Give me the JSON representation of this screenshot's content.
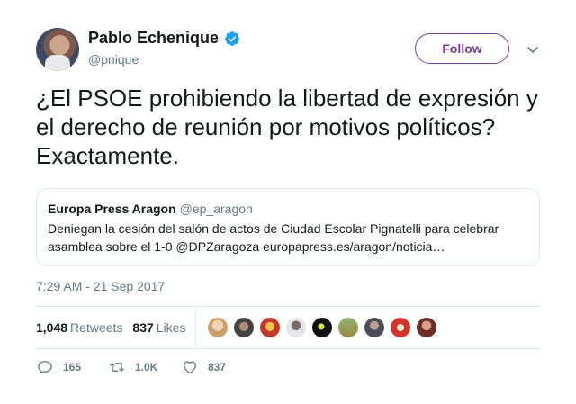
{
  "author": {
    "name": "Pablo Echenique",
    "handle": "@pnique",
    "verified": true
  },
  "follow_label": "Follow",
  "tweet_text": "¿El PSOE prohibiendo la libertad de expresión y el derecho de reunión por motivos políticos? Exactamente.",
  "quoted": {
    "name": "Europa Press Aragon",
    "handle": "@ep_aragon",
    "text": "Deniegan la cesión del salón de actos de Ciudad Escolar Pignatelli para celebrar asamblea sobre el 1-0 @DPZaragoza europapress.es/aragon/noticia…"
  },
  "timestamp": "7:29 AM - 21 Sep 2017",
  "stats": {
    "retweets_count": "1,048",
    "retweets_label": "Retweets",
    "likes_count": "837",
    "likes_label": "Likes"
  },
  "actions": {
    "replies": "165",
    "retweets": "1.0K",
    "likes": "837"
  },
  "colors": {
    "follow_accent": "#7a3e96",
    "verified": "#1da1f2",
    "muted": "#657786"
  }
}
